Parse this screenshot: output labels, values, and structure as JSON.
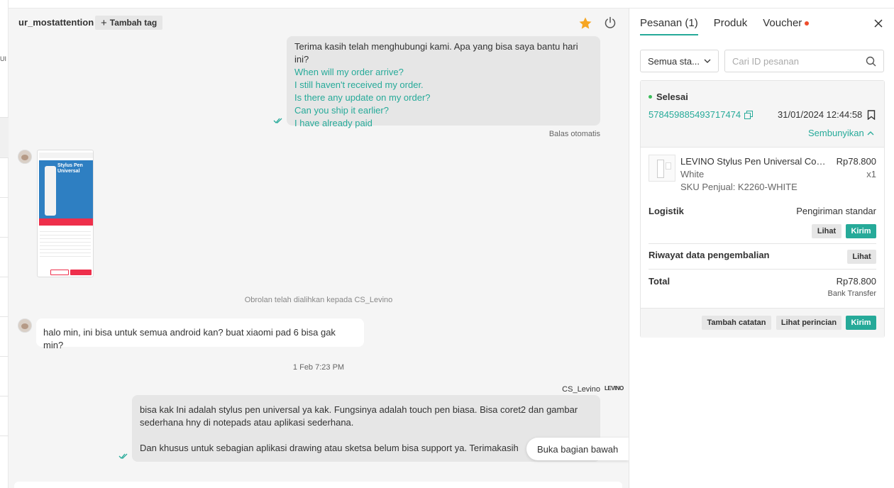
{
  "left_strip": {
    "fragment": "UI"
  },
  "chat": {
    "header": {
      "username": "ur_mostattention",
      "add_tag_label": "Tambah tag",
      "star_color": "#f6a623"
    },
    "auto_message": {
      "greeting": "Terima kasih telah menghubungi kami. Apa yang bisa saya bantu hari ini?",
      "quick_replies": [
        "When will my order arrive?",
        "I still haven't received my order.",
        "Is there any update on my order?",
        "Can you ship it earlier?",
        "I have already paid"
      ],
      "footer": "Balas otomatis"
    },
    "product_image": {
      "title": "Stylus Pen Universal"
    },
    "system_message": "Obrolan telah dialihkan kepada CS_Levino",
    "buyer_message": "halo min, ini bisa untuk semua android kan? buat xiaomi pad 6 bisa gak min?",
    "date_divider": "1 Feb 7:23 PM",
    "agent_name": "CS_Levino",
    "agent_logo": "LEVINO",
    "agent_message": {
      "line1": "bisa kak Ini adalah stylus pen universal ya kak. Fungsinya adalah touch pen biasa. Bisa coret2 dan gambar sederhana hny di notepads atau aplikasi sederhana.",
      "line2": "Dan khusus untuk sebagian aplikasi drawing atau sketsa belum bisa support ya. Terimakasih"
    },
    "open_bottom_label": "Buka bagian bawah"
  },
  "panel": {
    "tabs": [
      {
        "label": "Pesanan (1)"
      },
      {
        "label": "Produk"
      },
      {
        "label": "Voucher"
      }
    ],
    "accent_color": "#26aa99",
    "filter_select": "Semua sta...",
    "search_placeholder": "Cari ID pesanan",
    "order": {
      "status": "Selesai",
      "id": "578459885493717474",
      "date": "31/01/2024 12:44:58",
      "hide_label": "Sembunyikan",
      "item": {
        "name": "LEVINO Stylus Pen Universal Compatible",
        "price": "Rp78.800",
        "variant": "White",
        "qty": "x1",
        "sku": "SKU Penjual: K2260-WHITE"
      },
      "logistics_label": "Logistik",
      "logistics_value": "Pengiriman standar",
      "view_label": "Lihat",
      "send_label": "Kirim",
      "return_label": "Riwayat data pengembalian",
      "return_view_label": "Lihat",
      "total_label": "Total",
      "total_value": "Rp78.800",
      "payment_method": "Bank Transfer",
      "add_note_label": "Tambah catatan",
      "details_label": "Lihat perincian",
      "footer_send_label": "Kirim"
    }
  }
}
